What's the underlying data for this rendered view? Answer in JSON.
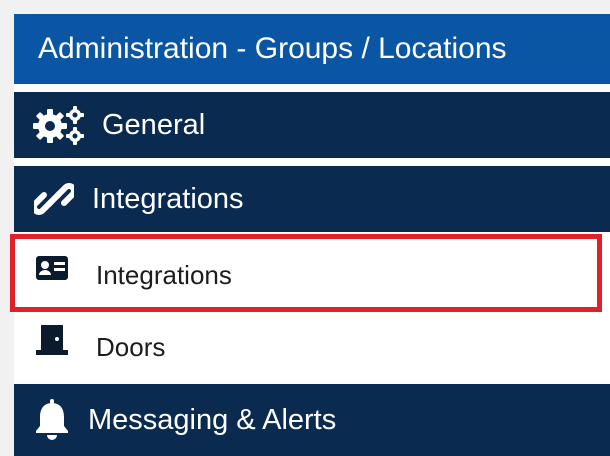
{
  "header": {
    "title": "Administration - Groups / Locations"
  },
  "sections": {
    "general": {
      "label": "General",
      "icon": "gears-icon"
    },
    "integrations": {
      "label": "Integrations",
      "icon": "link-icon"
    },
    "messaging": {
      "label": "Messaging & Alerts",
      "icon": "bell-icon"
    }
  },
  "items": {
    "integrations": {
      "label": "Integrations",
      "icon": "id-card-icon",
      "selected": true
    },
    "doors": {
      "label": "Doors",
      "icon": "door-icon"
    }
  },
  "colors": {
    "header_bg": "#0b56a4",
    "section_bg": "#0a2a4f",
    "highlight_border": "#e12129"
  }
}
